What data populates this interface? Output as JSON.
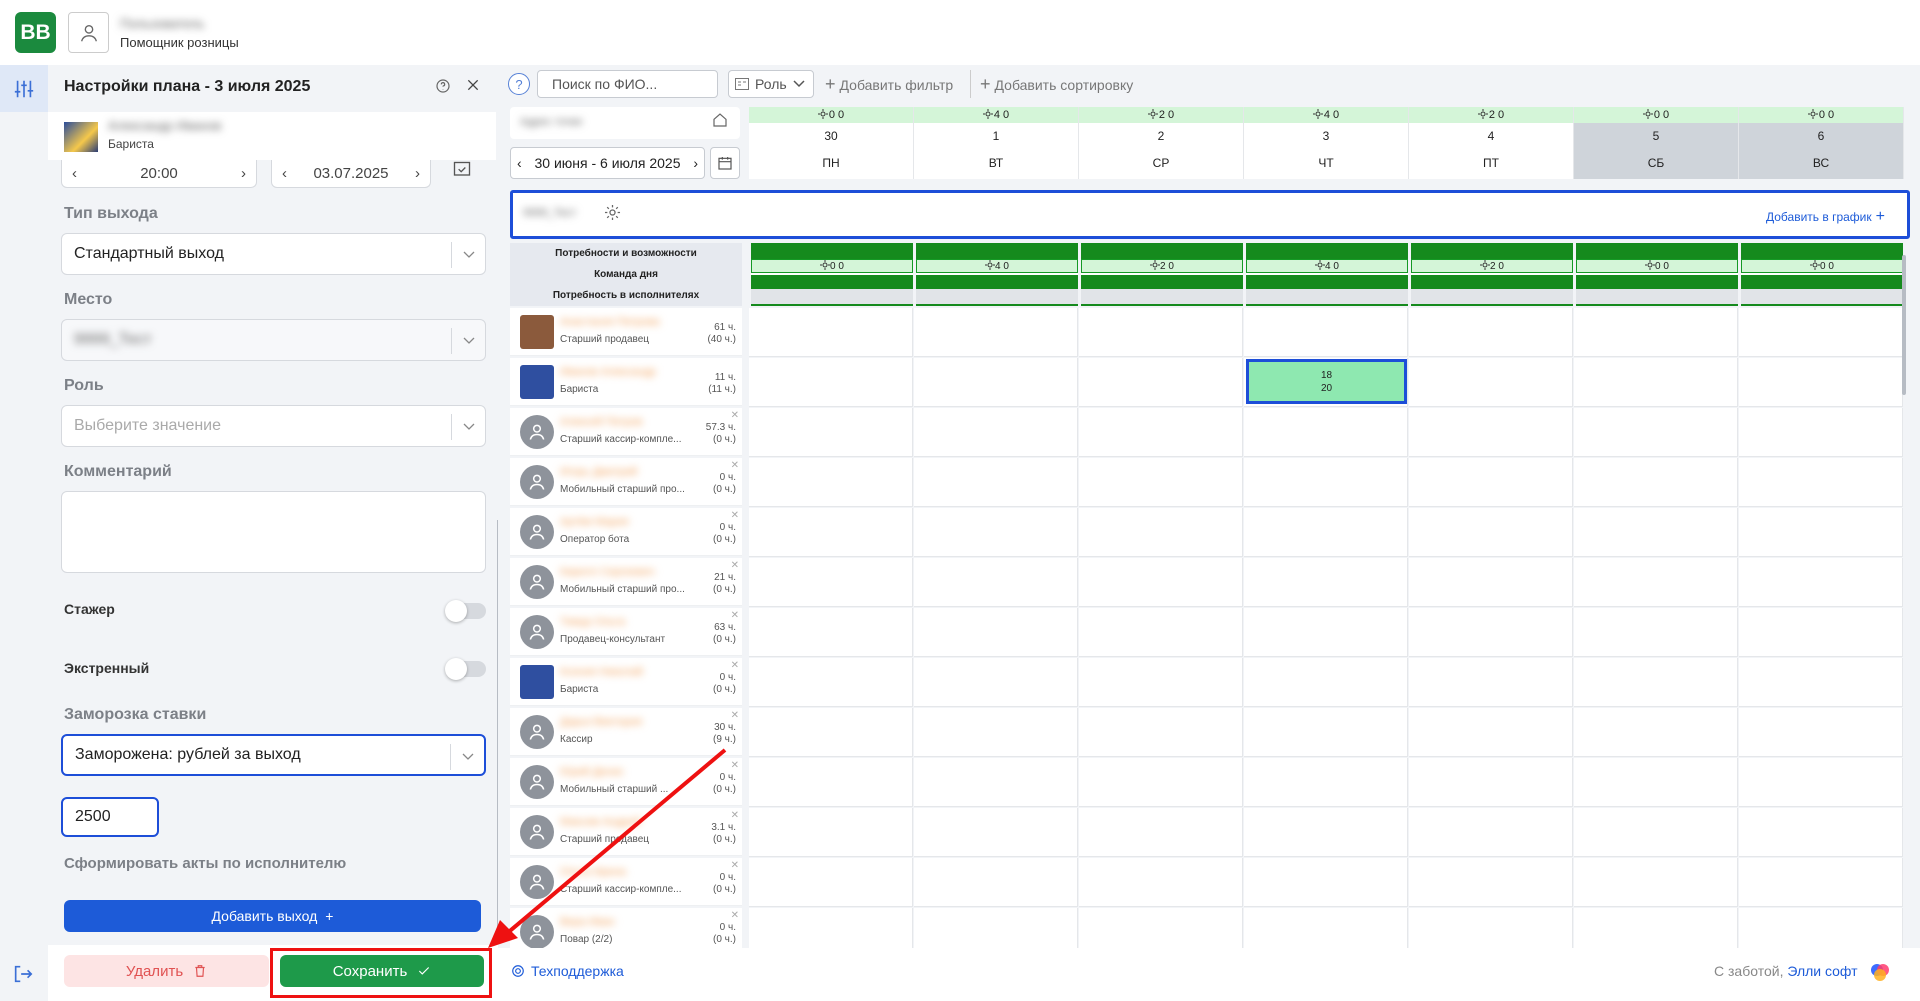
{
  "app": {
    "logo_text": "BB",
    "user_name": "Пользователь",
    "user_role": "Помощник розницы"
  },
  "panel": {
    "title": "Настройки плана - 3 июля 2025",
    "employee_name": "Александр Иванов",
    "employee_role": "Бариста",
    "time_value": "20:00",
    "date_value": "03.07.2025",
    "shift_type_label": "Тип выхода",
    "shift_type_value": "Стандартный выход",
    "place_label": "Место",
    "place_value": "9999_Тест",
    "role_label": "Роль",
    "role_placeholder": "Выберите значение",
    "comment_label": "Комментарий",
    "intern_label": "Стажер",
    "emergency_label": "Экстренный",
    "freeze_label": "Заморозка ставки",
    "freeze_value": "Заморожена: рублей за выход",
    "rate_value": "2500",
    "acts_label": "Сформировать акты по исполнителю",
    "add_shift": "Добавить выход",
    "delete": "Удалить",
    "save": "Сохранить"
  },
  "toolbar": {
    "help": "?",
    "search_placeholder": "Поиск по ФИО...",
    "role_filter": "Роль",
    "add_filter": "Добавить фильтр",
    "add_sort": "Добавить сортировку"
  },
  "schedule": {
    "location_name": "Адрес точки",
    "week_range": "30 июня - 6 июля 2025",
    "row_location": "9999_Тест",
    "add_to_schedule": "Добавить в график",
    "needs_labels": [
      "Потребности и возможности",
      "Команда дня",
      "Потребность в исполнителях"
    ],
    "days": [
      {
        "num": "30",
        "name": "ПН",
        "weather": "0 0",
        "needs": "0 0",
        "weekend": false
      },
      {
        "num": "1",
        "name": "ВТ",
        "weather": "4 0",
        "needs": "4 0",
        "weekend": false
      },
      {
        "num": "2",
        "name": "СР",
        "weather": "2 0",
        "needs": "2 0",
        "weekend": false
      },
      {
        "num": "3",
        "name": "ЧТ",
        "weather": "4 0",
        "needs": "4 0",
        "weekend": false
      },
      {
        "num": "4",
        "name": "ПТ",
        "weather": "2 0",
        "needs": "2 0",
        "weekend": false
      },
      {
        "num": "5",
        "name": "СБ",
        "weather": "0 0",
        "needs": "0 0",
        "weekend": true
      },
      {
        "num": "6",
        "name": "ВС",
        "weather": "0 0",
        "needs": "0 0",
        "weekend": true
      }
    ],
    "employees": [
      {
        "name": "Анастасия Петрова",
        "role": "Старший продавец",
        "hours": "61 ч.",
        "sub": "(40 ч.)",
        "photo": true
      },
      {
        "name": "Иванов Александр",
        "role": "Бариста",
        "hours": "11 ч.",
        "sub": "(11 ч.)",
        "photo": true
      },
      {
        "name": "Алексей Петров",
        "role": "Старший кассир-компле...",
        "hours": "57.3 ч.",
        "sub": "(0 ч.)",
        "photo": false
      },
      {
        "name": "Игорь Дмитрий",
        "role": "Мобильный старший про...",
        "hours": "0 ч.",
        "sub": "(0 ч.)",
        "photo": false
      },
      {
        "name": "Артём Мария",
        "role": "Оператор бота",
        "hours": "0 ч.",
        "sub": "(0 ч.)",
        "photo": false
      },
      {
        "name": "Кирилл Сергеевич",
        "role": "Мобильный старший про...",
        "hours": "21 ч.",
        "sub": "(0 ч.)",
        "photo": false
      },
      {
        "name": "Тимур Ольга",
        "role": "Продавец-консультант",
        "hours": "63 ч.",
        "sub": "(0 ч.)",
        "photo": false
      },
      {
        "name": "Ксения Николай",
        "role": "Бариста",
        "hours": "0 ч.",
        "sub": "(0 ч.)",
        "photo": true
      },
      {
        "name": "Дарья Виктория",
        "role": "Кассир",
        "hours": "30 ч.",
        "sub": "(9 ч.)",
        "photo": false
      },
      {
        "name": "Юрий Денис",
        "role": "Мобильный старший ...",
        "hours": "0 ч.",
        "sub": "(0 ч.)",
        "photo": false
      },
      {
        "name": "Максим Андрей",
        "role": "Старший продавец",
        "hours": "3.1 ч.",
        "sub": "(0 ч.)",
        "photo": false
      },
      {
        "name": "Ольга Ирина",
        "role": "Старший кассир-компле...",
        "hours": "0 ч.",
        "sub": "(0 ч.)",
        "photo": false
      },
      {
        "name": "Вера Иван",
        "role": "Повар (2/2)",
        "hours": "0 ч.",
        "sub": "(0 ч.)",
        "photo": false
      }
    ],
    "shift": {
      "line1": "18",
      "line2": "20"
    }
  },
  "footer": {
    "support": "Техподдержка",
    "credit_prefix": "С заботой, ",
    "credit_brand": "Элли софт"
  }
}
